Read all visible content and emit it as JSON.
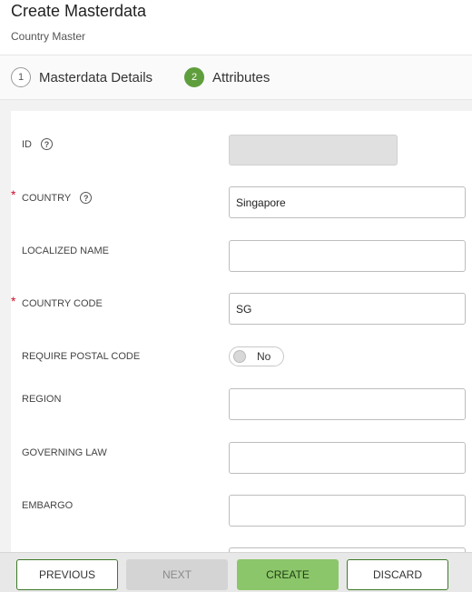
{
  "header": {
    "title": "Create Masterdata",
    "subtitle": "Country Master"
  },
  "steps": [
    {
      "number": "1",
      "label": "Masterdata Details",
      "state": "inactive"
    },
    {
      "number": "2",
      "label": "Attributes",
      "state": "active"
    }
  ],
  "form": {
    "id": {
      "label": "ID",
      "value": "",
      "disabled": true
    },
    "country": {
      "label": "COUNTRY",
      "required_mark": "*",
      "value": "Singapore"
    },
    "localized_name": {
      "label": "LOCALIZED NAME",
      "value": ""
    },
    "country_code": {
      "label": "COUNTRY CODE",
      "required_mark": "*",
      "value": "SG"
    },
    "require_postal_code": {
      "label": "REQUIRE POSTAL CODE",
      "toggle_text": "No",
      "on": false
    },
    "region": {
      "label": "REGION",
      "value": ""
    },
    "governing_law": {
      "label": "GOVERNING LAW",
      "value": ""
    },
    "embargo": {
      "label": "EMBARGO",
      "value": ""
    }
  },
  "help_icon_glyph": "?",
  "footer": {
    "previous_label": "PREVIOUS",
    "next_label": "NEXT",
    "create_label": "CREATE",
    "discard_label": "DISCARD"
  },
  "colors": {
    "accent_green": "#5f9e3d",
    "create_button": "#8cc66a",
    "required_red": "#c8102e"
  }
}
